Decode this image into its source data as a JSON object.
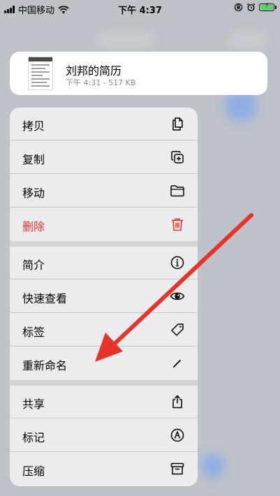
{
  "status_bar": {
    "carrier": "中国移动",
    "time": "下午 4:37",
    "battery_color": "#4cd964"
  },
  "file": {
    "name": "刘邦的简历",
    "meta": "下午 4:31 - 517 KB"
  },
  "menu": {
    "copy": "拷贝",
    "duplicate": "复制",
    "move": "移动",
    "delete": "删除",
    "info": "简介",
    "quick_look": "快速查看",
    "tags": "标签",
    "rename": "重新命名",
    "share": "共享",
    "markup": "标记",
    "compress": "压缩"
  },
  "colors": {
    "danger": "#e5332a",
    "annotation_arrow": "#e8332b"
  }
}
